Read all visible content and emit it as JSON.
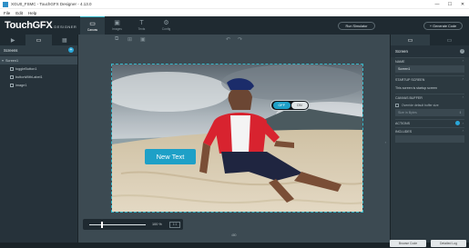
{
  "window": {
    "title": "XGU0_FSMC - TouchGFX Designer - 4.13.0",
    "minimize": "—",
    "maximize": "☐",
    "close": "✕"
  },
  "menu": [
    "File",
    "Edit",
    "Help"
  ],
  "logo": {
    "main": "TouchGFX",
    "sub": "DESIGNER"
  },
  "nav_tabs": [
    {
      "label": "Canvas",
      "icon": "▭",
      "active": true
    },
    {
      "label": "Images",
      "icon": "▣",
      "active": false
    },
    {
      "label": "Texts",
      "icon": "T",
      "active": false
    },
    {
      "label": "Config",
      "icon": "⚙",
      "active": false
    }
  ],
  "toolbar": {
    "run_simulator": "Run Simulator",
    "generate_code": "+ Generate Code"
  },
  "left_panel": {
    "tab_icons": [
      "▶",
      "▭",
      "▦"
    ],
    "screens_title": "Screens",
    "add": "+",
    "tree": [
      {
        "label": "Screen1",
        "twist": "▾",
        "indent": false
      },
      {
        "label": "toggleButton1",
        "twist": "",
        "indent": true
      },
      {
        "label": "buttonWithLabel1",
        "twist": "",
        "indent": true
      },
      {
        "label": "image1",
        "twist": "",
        "indent": true
      }
    ]
  },
  "canvas": {
    "text_button_label": "New Text",
    "toggle_off": "OFF",
    "toggle_on": "ON",
    "zoom_value": 100,
    "zoom_text": "100 %",
    "zoom_fit": "1:1",
    "canvas_size": "480",
    "tool_icons": [
      "⧉",
      "⊞",
      "▣",
      "↶",
      "↷"
    ]
  },
  "right_panel": {
    "tab_icons": [
      "▭",
      "▭"
    ],
    "title": "Screen",
    "help": "?",
    "name_section": "NAME",
    "name_value": "Screen1",
    "startup_section": "STARTUP SCREEN",
    "startup_text": "This screen is startup screen",
    "canvas_buffer_section": "CANVAS BUFFER",
    "override_label": "Override default buffer size",
    "buffer_placeholder": "Size in Bytes",
    "actions_section": "ACTIONS",
    "includes_section": "INCLUDES"
  },
  "bottom_buttons": {
    "browse_code": "Browse Code",
    "detailed_log": "Detailed Log"
  },
  "colors": {
    "accent": "#1ea0c7",
    "panel": "#2c3940",
    "canvas_bg": "#3c4a52"
  }
}
